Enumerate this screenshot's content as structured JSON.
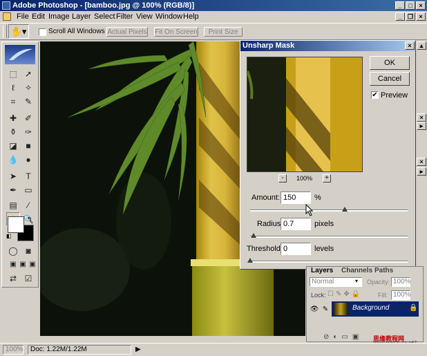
{
  "window": {
    "title": "Adobe Photoshop - [bamboo.jpg @ 100% (RGB/8)]"
  },
  "menu": [
    "File",
    "Edit",
    "Image",
    "Layer",
    "Select",
    "Filter",
    "View",
    "Window",
    "Help"
  ],
  "options_bar": {
    "scroll_all_windows": "Scroll All Windows",
    "actual_pixels": "Actual Pixels",
    "fit_on_screen": "Fit On Screen",
    "print_size": "Print Size"
  },
  "dialog": {
    "title": "Unsharp Mask",
    "ok": "OK",
    "cancel": "Cancel",
    "preview_label": "Preview",
    "preview_checked": "✔",
    "zoom": "100%",
    "zoom_out": "-",
    "zoom_in": "+",
    "amount_label": "Amount:",
    "amount_value": "150",
    "amount_unit": "%",
    "amount_slider_fraction": 0.6,
    "radius_label": "Radius:",
    "radius_value": "0.7",
    "radius_unit": "pixels",
    "radius_slider_fraction": 0.02,
    "threshold_label": "Threshold:",
    "threshold_value": "0",
    "threshold_unit": "levels",
    "threshold_slider_fraction": 0.0
  },
  "layers_panel": {
    "tabs": [
      "Layers",
      "Channels",
      "Paths"
    ],
    "blend_mode": "Normal",
    "opacity_label": "Opacity:",
    "opacity_value": "100%",
    "lock_label": "Lock:",
    "fill_label": "Fill:",
    "fill_value": "100%",
    "layer_name": "Background"
  },
  "status_bar": {
    "zoom": "100%",
    "doc_size": "Doc: 1.22M/1.22M"
  },
  "watermark": {
    "text": "思缘教程网",
    "url": "WWW.MISSYUAN.NET"
  },
  "colors": {
    "title_bar": "#0a246a",
    "panel": "#d4d0c8",
    "layer_selected": "#0a246a"
  }
}
